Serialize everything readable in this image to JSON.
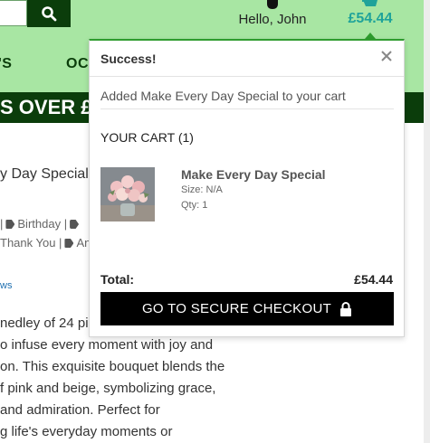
{
  "header": {
    "greeting": "Hello, John",
    "cart_total": "£54.44",
    "search_icon": "search-icon",
    "account_icon": "user-icon",
    "cart_icon": "cart-icon"
  },
  "nav": {
    "items": [
      "'S",
      "OC"
    ]
  },
  "banner": {
    "text": "S OVER £5"
  },
  "product": {
    "title": "y Day Special",
    "tags_line1_a": "|",
    "tags_line1_b": "Birthday |",
    "tags_line2_a": "Thank You |",
    "tags_line2_b": "An",
    "reviews_link": "ws",
    "description": [
      "nedley of 24 pi",
      "o infuse every moment with joy and",
      "on. This exquisite bouquet blends the",
      "f pink and beige, symbolizing grace,",
      "and admiration. Perfect for",
      "g life's everyday moments or"
    ]
  },
  "popup": {
    "title": "Success!",
    "close_icon": "close-icon",
    "message": "Added Make Every Day Special to your cart",
    "cart_heading": "YOUR CART (1)",
    "item": {
      "name": "Make Every Day Special",
      "size": "Size: N/A",
      "qty": "Qty: 1"
    },
    "total_label": "Total:",
    "total_value": "£54.44",
    "checkout_label": "GO TO SECURE CHECKOUT",
    "lock_icon": "lock-icon"
  },
  "colors": {
    "header_bg": "#a8e6a3",
    "dark_green": "#0b3d0b",
    "cart_total": "#1fa39a",
    "success_border": "#2e9c2e",
    "checkout_bg": "#000000"
  }
}
